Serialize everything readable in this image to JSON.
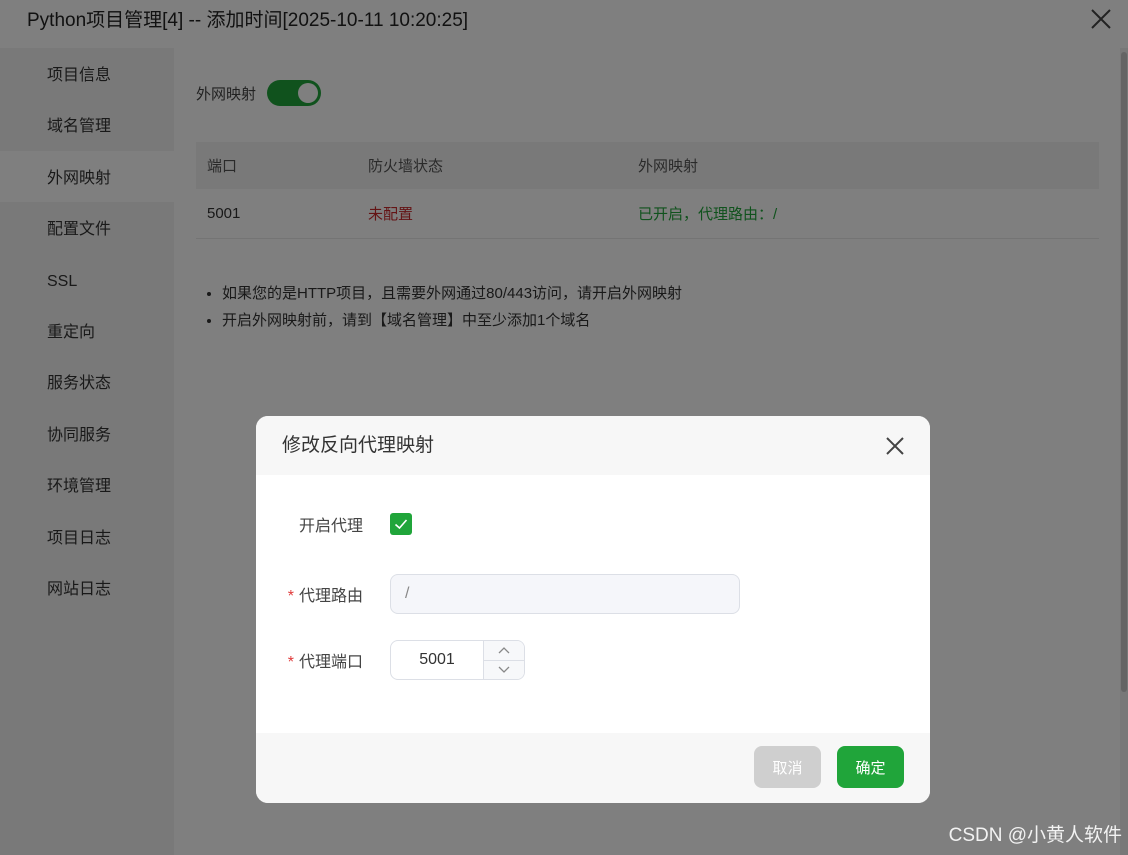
{
  "window": {
    "title": "Python项目管理[4] -- 添加时间[2025-10-11 10:20:25]"
  },
  "sidebar": {
    "items": [
      {
        "label": "项目信息"
      },
      {
        "label": "域名管理"
      },
      {
        "label": "外网映射"
      },
      {
        "label": "配置文件"
      },
      {
        "label": "SSL"
      },
      {
        "label": "重定向"
      },
      {
        "label": "服务状态"
      },
      {
        "label": "协同服务"
      },
      {
        "label": "环境管理"
      },
      {
        "label": "项目日志"
      },
      {
        "label": "网站日志"
      }
    ],
    "active": "外网映射"
  },
  "main": {
    "toggle_label": "外网映射",
    "toggle_on": true,
    "table": {
      "headers": [
        "端口",
        "防火墙状态",
        "外网映射"
      ],
      "rows": [
        {
          "port": "5001",
          "firewall": "未配置",
          "mapping": "已开启，代理路由：/"
        }
      ]
    },
    "tips": [
      "如果您的是HTTP项目，且需要外网通过80/443访问，请开启外网映射",
      "开启外网映射前，请到【域名管理】中至少添加1个域名"
    ]
  },
  "dialog": {
    "title": "修改反向代理映射",
    "enable_label": "开启代理",
    "enable_checked": true,
    "route_label": "代理路由",
    "route_required": "*",
    "route_value": "/",
    "port_label": "代理端口",
    "port_required": "*",
    "port_value": "5001",
    "cancel_label": "取消",
    "ok_label": "确定"
  },
  "watermark": "CSDN @小黄人软件",
  "colors": {
    "accent": "#20a53a",
    "danger": "#c8282b"
  }
}
